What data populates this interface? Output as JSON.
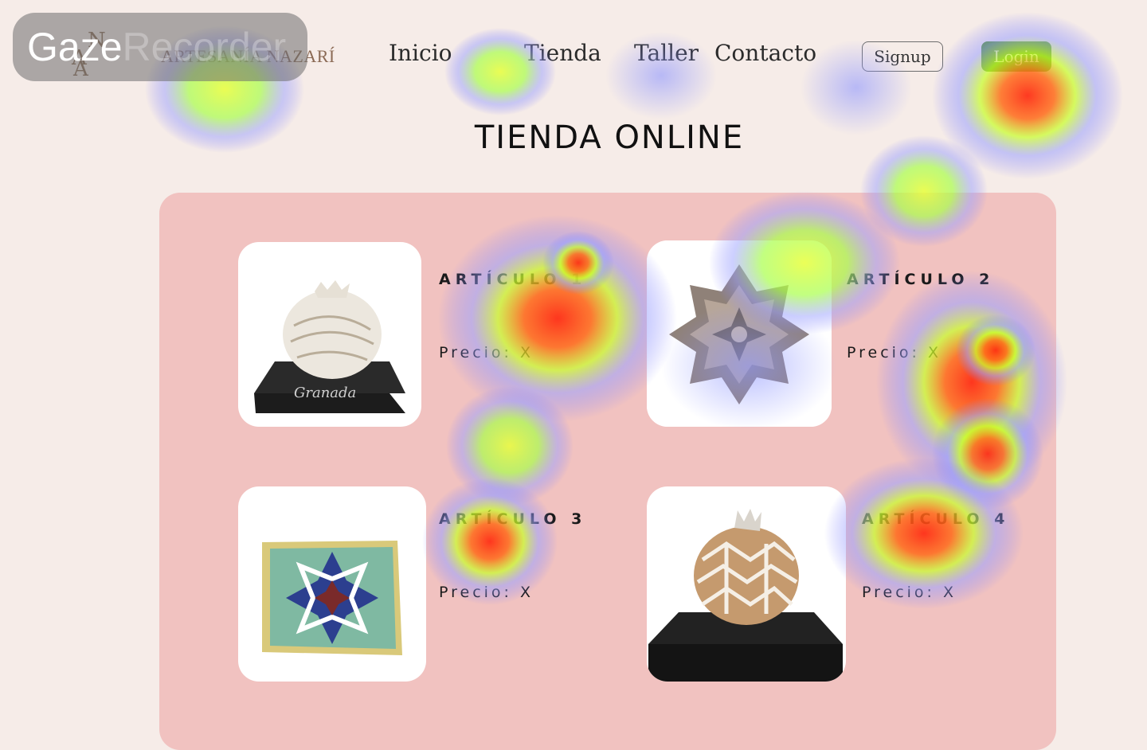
{
  "header": {
    "logo": {
      "monogram": [
        "A",
        "N",
        "A"
      ],
      "brand": "ARTESANÍA NAZARÍ"
    },
    "nav": [
      {
        "label": "Inicio"
      },
      {
        "label": "Tienda"
      },
      {
        "label": "Taller"
      },
      {
        "label": "Contacto"
      }
    ],
    "signup_label": "Signup",
    "login_label": "Login"
  },
  "main": {
    "title": "TIENDA ONLINE",
    "products": [
      {
        "title": "ARTÍCULO 1",
        "price": "Precio: X",
        "image": "pomegranate-granada-vase",
        "image_caption": "Granada"
      },
      {
        "title": "ARTÍCULO 2",
        "price": "Precio: X",
        "image": "star-ceramic-ornament"
      },
      {
        "title": "ARTÍCULO 3",
        "price": "Precio: X",
        "image": "geometric-tile"
      },
      {
        "title": "ARTÍCULO 4",
        "price": "Precio: X",
        "image": "carved-pomegranate"
      }
    ]
  },
  "watermark": {
    "part1": "Gaze",
    "part2": "Recorder"
  },
  "colors": {
    "background": "#f6ece8",
    "panel": "#f1c2c0",
    "login": "#4a8f1c"
  }
}
